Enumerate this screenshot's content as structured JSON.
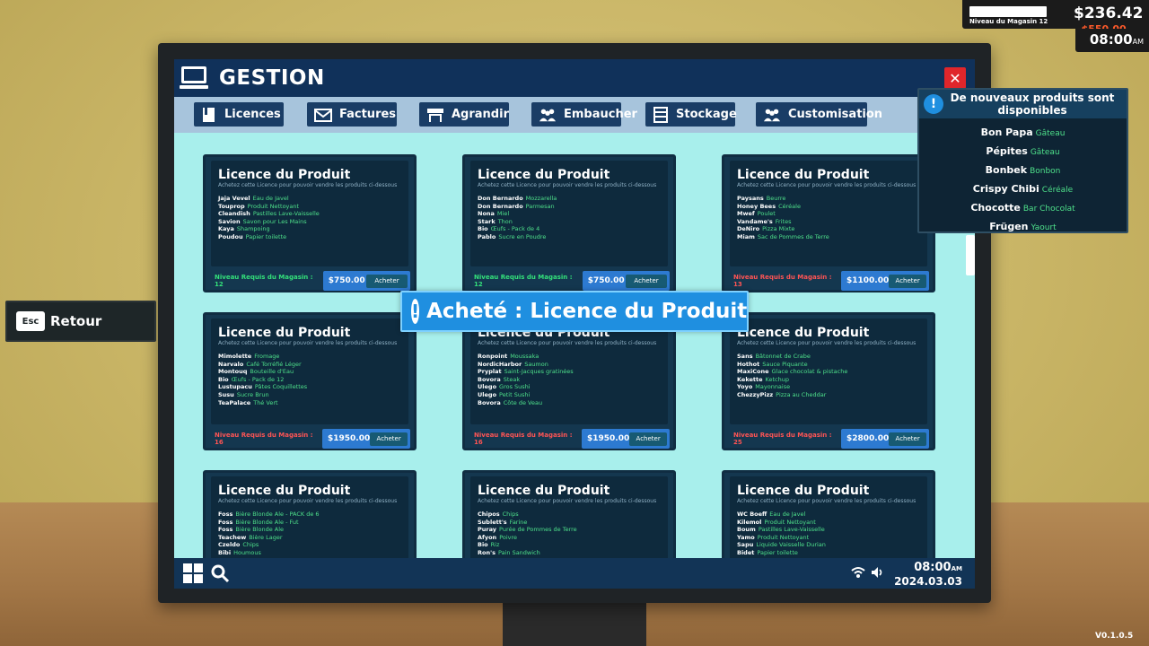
{
  "hud": {
    "level_label": "Niveau du Magasin 12",
    "level_progress": 1.0,
    "money": "$236.42",
    "money_change": "-$550.00",
    "time": "08:00",
    "time_suffix": "AM"
  },
  "window": {
    "title": "GESTION",
    "close_label": "✕"
  },
  "tabs": [
    {
      "label": "Licences",
      "icon": "book-icon"
    },
    {
      "label": "Factures",
      "icon": "mail-icon"
    },
    {
      "label": "Agrandir",
      "icon": "shop-icon"
    },
    {
      "label": "Embaucher",
      "icon": "people-icon"
    },
    {
      "label": "Stockage",
      "icon": "cabinet-icon"
    },
    {
      "label": "Customisation",
      "icon": "people-icon"
    }
  ],
  "card_title": "Licence du Produit",
  "card_subtitle": "Achetez cette Licence pour pouvoir vendre les produits ci-dessous",
  "buy_label": "Acheter",
  "cards": [
    {
      "products": [
        [
          "Jaja Vevel",
          "Eau de Javel"
        ],
        [
          "Touprop",
          "Produit Nettoyant"
        ],
        [
          "Cleandish",
          "Pastilles Lave-Vaisselle"
        ],
        [
          "Savion",
          "Savon pour Les Mains"
        ],
        [
          "Kaya",
          "Shampoing"
        ],
        [
          "Poudou",
          "Papier toilette"
        ]
      ],
      "req": "Niveau Requis du Magasin : 12",
      "req_ok": true,
      "price": "$750.00"
    },
    {
      "products": [
        [
          "Don Bernardo",
          "Mozzarella"
        ],
        [
          "Don Bernardo",
          "Parmesan"
        ],
        [
          "Nona",
          "Miel"
        ],
        [
          "Stark",
          "Thon"
        ],
        [
          "Bio",
          "Œufs - Pack de 4"
        ],
        [
          "Pablo",
          "Sucre en Poudre"
        ]
      ],
      "req": "Niveau Requis du Magasin : 12",
      "req_ok": true,
      "price": "$750.00"
    },
    {
      "products": [
        [
          "Paysans",
          "Beurre"
        ],
        [
          "Honey Bees",
          "Céréale"
        ],
        [
          "Mwef",
          "Poulet"
        ],
        [
          "Vandame's",
          "Frites"
        ],
        [
          "DeNiro",
          "Pizza Mixte"
        ],
        [
          "Miam",
          "Sac de Pommes de Terre"
        ]
      ],
      "req": "Niveau Requis du Magasin : 13",
      "req_ok": false,
      "price": "$1100.00"
    },
    {
      "products": [
        [
          "Mimolette",
          "Fromage"
        ],
        [
          "Narvalo",
          "Café Torréfié Léger"
        ],
        [
          "Montouq",
          "Bouteille d'Eau"
        ],
        [
          "Bio",
          "Œufs - Pack de 12"
        ],
        [
          "Lustupacu",
          "Pâtes Coquillettes"
        ],
        [
          "Susu",
          "Sucre Brun"
        ],
        [
          "TeaPalace",
          "Thé Vert"
        ]
      ],
      "req": "Niveau Requis du Magasin : 16",
      "req_ok": false,
      "price": "$1950.00"
    },
    {
      "products": [
        [
          "Ronpoint",
          "Moussaka"
        ],
        [
          "NordicHarbor",
          "Saumon"
        ],
        [
          "Pryplat",
          "Saint-Jacques gratinées"
        ],
        [
          "Bovora",
          "Steak"
        ],
        [
          "Ulego",
          "Gros Sushi"
        ],
        [
          "Ulego",
          "Petit Sushi"
        ],
        [
          "Bovora",
          "Côte de Veau"
        ]
      ],
      "req": "Niveau Requis du Magasin : 16",
      "req_ok": false,
      "price": "$1950.00"
    },
    {
      "products": [
        [
          "Sans",
          "Bâtonnet de Crabe"
        ],
        [
          "Hothot",
          "Sauce Piquante"
        ],
        [
          "MaxiCone",
          "Glace chocolat & pistache"
        ],
        [
          "Kekette",
          "Ketchup"
        ],
        [
          "Yoyo",
          "Mayonnaise"
        ],
        [
          "ChezzyPizz",
          "Pizza au Cheddar"
        ]
      ],
      "req": "Niveau Requis du Magasin : 25",
      "req_ok": false,
      "price": "$2800.00"
    },
    {
      "products": [
        [
          "Foss",
          "Bière Blonde Ale - PACK de 6"
        ],
        [
          "Foss",
          "Bière Blonde Ale - Fut"
        ],
        [
          "Foss",
          "Bière Blonde Ale"
        ],
        [
          "Teachew",
          "Bière Lager"
        ],
        [
          "Czeldo",
          "Chips"
        ],
        [
          "Bibi",
          "Houmous"
        ]
      ],
      "req": "",
      "req_ok": false,
      "price": ""
    },
    {
      "products": [
        [
          "Chipos",
          "Chips"
        ],
        [
          "Sublett's",
          "Farine"
        ],
        [
          "Puray",
          "Purée de Pommes de Terre"
        ],
        [
          "Afyon",
          "Poivre"
        ],
        [
          "Bio",
          "Riz"
        ],
        [
          "Ron's",
          "Pain Sandwich"
        ]
      ],
      "req": "",
      "req_ok": false,
      "price": ""
    },
    {
      "products": [
        [
          "WC Boeff",
          "Eau de Javel"
        ],
        [
          "Kilemol",
          "Produit Nettoyant"
        ],
        [
          "Boum",
          "Pastilles Lave-Vaisselle"
        ],
        [
          "Yamo",
          "Produit Nettoyant"
        ],
        [
          "Sapu",
          "Liquide Vaisselle Durian"
        ],
        [
          "Bidet",
          "Papier toilette"
        ]
      ],
      "req": "",
      "req_ok": false,
      "price": ""
    }
  ],
  "toast": {
    "icon": "!",
    "text": "Acheté : Licence du Produit"
  },
  "notification": {
    "icon": "!",
    "title": "De nouveaux produits sont disponibles",
    "items": [
      {
        "name": "Bon Papa",
        "cat": "Gâteau"
      },
      {
        "name": "Pépites",
        "cat": "Gâteau"
      },
      {
        "name": "Bonbek",
        "cat": "Bonbon"
      },
      {
        "name": "Crispy Chibi",
        "cat": "Céréale"
      },
      {
        "name": "Chocotte",
        "cat": "Bar Chocolat"
      },
      {
        "name": "Frügen",
        "cat": "Yaourt"
      }
    ]
  },
  "back": {
    "key": "Esc",
    "label": "Retour"
  },
  "taskbar": {
    "time": "08:00",
    "time_suffix": "AM",
    "date": "2024.03.03"
  },
  "version": "V0.1.0.5",
  "colors": {
    "ok": "#33e07a",
    "no": "#ff5454",
    "accent": "#1f8fe0",
    "window_title": "#10315a"
  }
}
